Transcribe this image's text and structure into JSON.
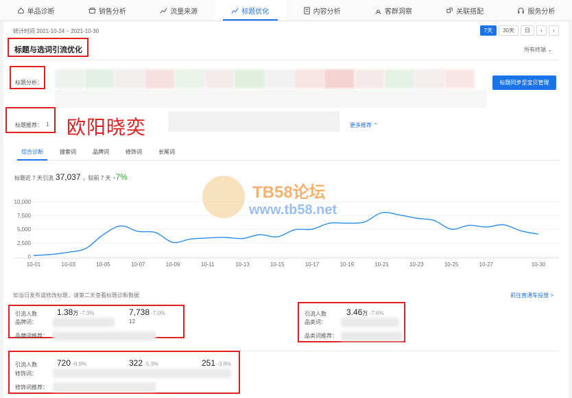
{
  "nav": {
    "tabs": [
      {
        "label": "单品诊断",
        "icon": "home-icon"
      },
      {
        "label": "销售分析",
        "icon": "store-icon"
      },
      {
        "label": "流量来源",
        "icon": "trend-icon"
      },
      {
        "label": "标题优化",
        "icon": "trend-icon",
        "active": true
      },
      {
        "label": "内容分析",
        "icon": "document-icon"
      },
      {
        "label": "客群洞察",
        "icon": "people-icon"
      },
      {
        "label": "关联搭配",
        "icon": "link-icon"
      },
      {
        "label": "服务分析",
        "icon": "headset-icon"
      }
    ]
  },
  "header": {
    "stat_time": "统计时间 2021-10-24 ~ 2021-10-30",
    "range_buttons": [
      "7天",
      "30天",
      "日",
      "‹",
      "›"
    ],
    "title": "标题与选词引流优化",
    "store_filter": "所有终端 ⌄"
  },
  "analysis": {
    "title_analysis_label": "标题分析：",
    "sync_button": "标题同步至宝贝管理",
    "recommend_label": "标题推荐：",
    "recommend_index": "1",
    "more_recommend": "更多推荐 ⌃",
    "handwritten": "欧阳晓奕"
  },
  "subtabs": [
    "综合诊断",
    "搜索词",
    "品牌词",
    "修饰词",
    "长尾词"
  ],
  "flow_summary": {
    "prefix": "标题近 7 天引流",
    "value": "37,037",
    "compare": "，较前 7 天",
    "change": "-7%"
  },
  "chart_data": {
    "type": "line",
    "x": [
      "10-01",
      "10-02",
      "10-03",
      "10-04",
      "10-05",
      "10-06",
      "10-07",
      "10-08",
      "10-09",
      "10-10",
      "10-11",
      "10-12",
      "10-13",
      "10-14",
      "10-15",
      "10-16",
      "10-17",
      "10-18",
      "10-19",
      "10-20",
      "10-21",
      "10-22",
      "10-23",
      "10-24",
      "10-25",
      "10-26",
      "10-27",
      "10-28",
      "10-29",
      "10-30"
    ],
    "x_tick_labels": [
      "10-01",
      "10-03",
      "10-05",
      "10-07",
      "10-09",
      "10-11",
      "10-13",
      "10-15",
      "10-17",
      "10-19",
      "10-21",
      "10-23",
      "10-25",
      "10-27",
      "10-30"
    ],
    "series": [
      {
        "values": [
          200,
          400,
          800,
          1500,
          4000,
          5600,
          4600,
          4400,
          2600,
          3200,
          3400,
          3500,
          3300,
          4000,
          3600,
          4900,
          5000,
          6100,
          6100,
          6300,
          8000,
          7600,
          7000,
          6600,
          5000,
          5700,
          5400,
          5800,
          4700,
          4100
        ],
        "color": "#2b8de8"
      }
    ],
    "yticks": [
      "10,000",
      "7,500",
      "5,000",
      "2,500",
      "0"
    ],
    "ylim": [
      0,
      10000
    ],
    "grid": true
  },
  "footer_note": "如当日发布或修改标题，请第二天查看标题诊断数据",
  "goto_link": "前往直通车投放 >",
  "metrics": {
    "brand": {
      "label1": "引流人数",
      "label2": "品牌词：",
      "label3": "品牌词推荐：",
      "v1": "1.38",
      "u1": "万",
      "c1": "-7.3%",
      "v2": "7,738",
      "c2": "-7.0%",
      "sub2": "12"
    },
    "category": {
      "label1": "引流人数",
      "label2": "品类词：",
      "label3": "品类词推荐：",
      "v1": "3.46",
      "u1": "万",
      "c1": "-7.6%"
    },
    "modifier": {
      "label1": "引流人数",
      "label2": "修饰词：",
      "label3": "修饰词推荐：",
      "v1": "720",
      "c1": "-8.9%",
      "v2": "322",
      "c2": "-5.3%",
      "v3": "251",
      "c3": "-3.8%"
    }
  },
  "watermark": {
    "line1": "TB58论坛",
    "line2": "www.tb58.net"
  }
}
